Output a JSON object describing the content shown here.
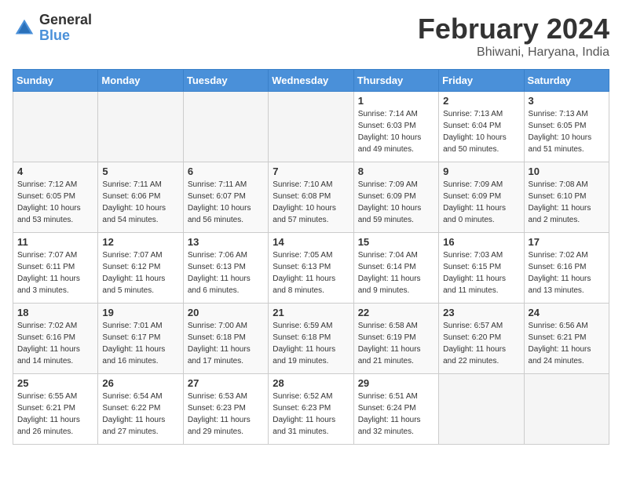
{
  "header": {
    "logo_general": "General",
    "logo_blue": "Blue",
    "month_title": "February 2024",
    "location": "Bhiwani, Haryana, India"
  },
  "days_of_week": [
    "Sunday",
    "Monday",
    "Tuesday",
    "Wednesday",
    "Thursday",
    "Friday",
    "Saturday"
  ],
  "weeks": [
    [
      {
        "day": "",
        "info": ""
      },
      {
        "day": "",
        "info": ""
      },
      {
        "day": "",
        "info": ""
      },
      {
        "day": "",
        "info": ""
      },
      {
        "day": "1",
        "info": "Sunrise: 7:14 AM\nSunset: 6:03 PM\nDaylight: 10 hours\nand 49 minutes."
      },
      {
        "day": "2",
        "info": "Sunrise: 7:13 AM\nSunset: 6:04 PM\nDaylight: 10 hours\nand 50 minutes."
      },
      {
        "day": "3",
        "info": "Sunrise: 7:13 AM\nSunset: 6:05 PM\nDaylight: 10 hours\nand 51 minutes."
      }
    ],
    [
      {
        "day": "4",
        "info": "Sunrise: 7:12 AM\nSunset: 6:05 PM\nDaylight: 10 hours\nand 53 minutes."
      },
      {
        "day": "5",
        "info": "Sunrise: 7:11 AM\nSunset: 6:06 PM\nDaylight: 10 hours\nand 54 minutes."
      },
      {
        "day": "6",
        "info": "Sunrise: 7:11 AM\nSunset: 6:07 PM\nDaylight: 10 hours\nand 56 minutes."
      },
      {
        "day": "7",
        "info": "Sunrise: 7:10 AM\nSunset: 6:08 PM\nDaylight: 10 hours\nand 57 minutes."
      },
      {
        "day": "8",
        "info": "Sunrise: 7:09 AM\nSunset: 6:09 PM\nDaylight: 10 hours\nand 59 minutes."
      },
      {
        "day": "9",
        "info": "Sunrise: 7:09 AM\nSunset: 6:09 PM\nDaylight: 11 hours\nand 0 minutes."
      },
      {
        "day": "10",
        "info": "Sunrise: 7:08 AM\nSunset: 6:10 PM\nDaylight: 11 hours\nand 2 minutes."
      }
    ],
    [
      {
        "day": "11",
        "info": "Sunrise: 7:07 AM\nSunset: 6:11 PM\nDaylight: 11 hours\nand 3 minutes."
      },
      {
        "day": "12",
        "info": "Sunrise: 7:07 AM\nSunset: 6:12 PM\nDaylight: 11 hours\nand 5 minutes."
      },
      {
        "day": "13",
        "info": "Sunrise: 7:06 AM\nSunset: 6:13 PM\nDaylight: 11 hours\nand 6 minutes."
      },
      {
        "day": "14",
        "info": "Sunrise: 7:05 AM\nSunset: 6:13 PM\nDaylight: 11 hours\nand 8 minutes."
      },
      {
        "day": "15",
        "info": "Sunrise: 7:04 AM\nSunset: 6:14 PM\nDaylight: 11 hours\nand 9 minutes."
      },
      {
        "day": "16",
        "info": "Sunrise: 7:03 AM\nSunset: 6:15 PM\nDaylight: 11 hours\nand 11 minutes."
      },
      {
        "day": "17",
        "info": "Sunrise: 7:02 AM\nSunset: 6:16 PM\nDaylight: 11 hours\nand 13 minutes."
      }
    ],
    [
      {
        "day": "18",
        "info": "Sunrise: 7:02 AM\nSunset: 6:16 PM\nDaylight: 11 hours\nand 14 minutes."
      },
      {
        "day": "19",
        "info": "Sunrise: 7:01 AM\nSunset: 6:17 PM\nDaylight: 11 hours\nand 16 minutes."
      },
      {
        "day": "20",
        "info": "Sunrise: 7:00 AM\nSunset: 6:18 PM\nDaylight: 11 hours\nand 17 minutes."
      },
      {
        "day": "21",
        "info": "Sunrise: 6:59 AM\nSunset: 6:18 PM\nDaylight: 11 hours\nand 19 minutes."
      },
      {
        "day": "22",
        "info": "Sunrise: 6:58 AM\nSunset: 6:19 PM\nDaylight: 11 hours\nand 21 minutes."
      },
      {
        "day": "23",
        "info": "Sunrise: 6:57 AM\nSunset: 6:20 PM\nDaylight: 11 hours\nand 22 minutes."
      },
      {
        "day": "24",
        "info": "Sunrise: 6:56 AM\nSunset: 6:21 PM\nDaylight: 11 hours\nand 24 minutes."
      }
    ],
    [
      {
        "day": "25",
        "info": "Sunrise: 6:55 AM\nSunset: 6:21 PM\nDaylight: 11 hours\nand 26 minutes."
      },
      {
        "day": "26",
        "info": "Sunrise: 6:54 AM\nSunset: 6:22 PM\nDaylight: 11 hours\nand 27 minutes."
      },
      {
        "day": "27",
        "info": "Sunrise: 6:53 AM\nSunset: 6:23 PM\nDaylight: 11 hours\nand 29 minutes."
      },
      {
        "day": "28",
        "info": "Sunrise: 6:52 AM\nSunset: 6:23 PM\nDaylight: 11 hours\nand 31 minutes."
      },
      {
        "day": "29",
        "info": "Sunrise: 6:51 AM\nSunset: 6:24 PM\nDaylight: 11 hours\nand 32 minutes."
      },
      {
        "day": "",
        "info": ""
      },
      {
        "day": "",
        "info": ""
      }
    ]
  ]
}
